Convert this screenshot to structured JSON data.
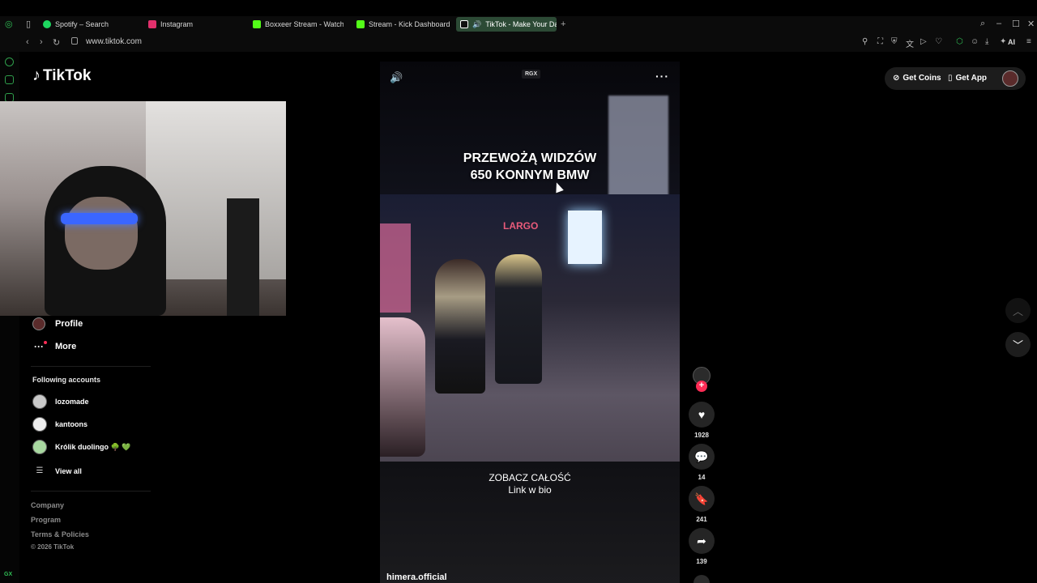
{
  "browser": {
    "tabs": [
      {
        "title": "Spotify – Search",
        "color": "#1ed760"
      },
      {
        "title": "Instagram",
        "color": "#e1306c"
      },
      {
        "title": "Boxxeer Stream - Watch L",
        "color": "#53fc18"
      },
      {
        "title": "Stream - Kick Dashboard",
        "color": "#53fc18"
      },
      {
        "title": "TikTok - Make Your Da",
        "color": "#ffffff"
      }
    ],
    "url": "www.tiktok.com",
    "ai_label": "AI",
    "gx_label": "GX"
  },
  "tiktok": {
    "logo": "TikTok",
    "nav": {
      "profile": "Profile",
      "more": "More"
    },
    "following": {
      "title": "Following accounts",
      "accounts": [
        "lozomade",
        "kantoons",
        "Królik duolingo 🌳 💚"
      ],
      "view_all": "View all"
    },
    "footer": {
      "links": [
        "Company",
        "Program",
        "Terms & Policies"
      ],
      "copyright": "© 2026 TikTok"
    },
    "video": {
      "caption_top_1": "PRZEWOŻĄ WIDZÓW",
      "caption_top_2": "650 KONNYM BMW",
      "shop_sign": "LARGO",
      "caption_bottom_1": "ZOBACZ CAŁOŚĆ",
      "caption_bottom_2": "Link w bio",
      "author": "himera.official",
      "badge": "RGX",
      "menu": "···"
    },
    "actions": {
      "likes": "1928",
      "comments": "14",
      "saves": "241",
      "shares": "139"
    },
    "top": {
      "get_coins": "Get Coins",
      "get_app": "Get App"
    }
  }
}
